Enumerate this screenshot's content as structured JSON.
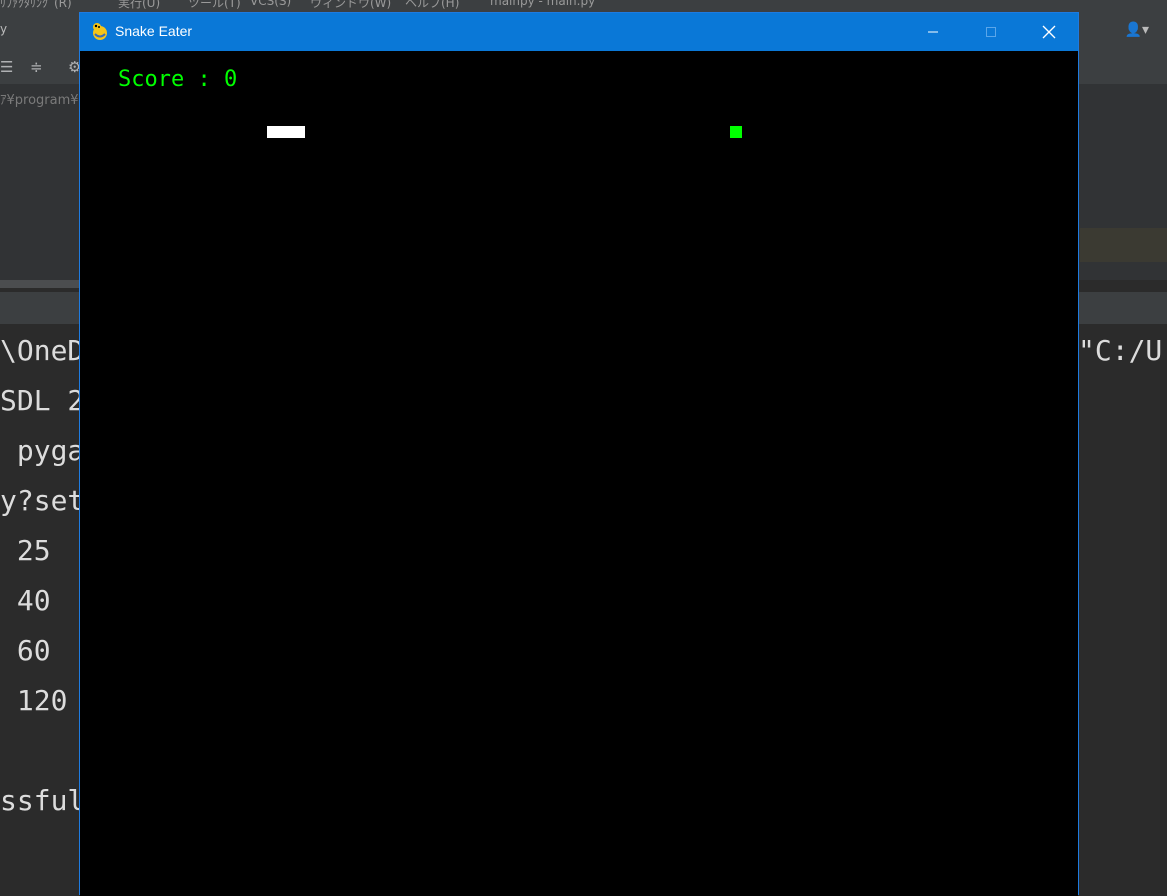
{
  "ide": {
    "menu_fragments": [
      "ﾘﾌｧｸﾀﾘﾝｸﾞ(R)",
      "実行(U)",
      "ツール(T)",
      "VCS(S)",
      "ウィンドウ(W)",
      "ヘルプ(H)",
      "mainpy - main.py"
    ],
    "left_top_text": "y",
    "path_fragment": "ｱ¥program¥",
    "console_lines": [
      "\\OneD",
      "SDL 2",
      " pyga",
      "y?set",
      " 25",
      " 40",
      " 60",
      " 120",
      "",
      "ssful"
    ],
    "console_right": "\"C:/U"
  },
  "window": {
    "title": "Snake Eater",
    "minimize_glyph": "—",
    "maximize_glyph": "☐",
    "close_glyph": "✕"
  },
  "game": {
    "score_label": "Score : 0",
    "score": 0,
    "snake_color": "#ffffff",
    "food_color": "#00ff00",
    "score_color": "#00ff00"
  }
}
